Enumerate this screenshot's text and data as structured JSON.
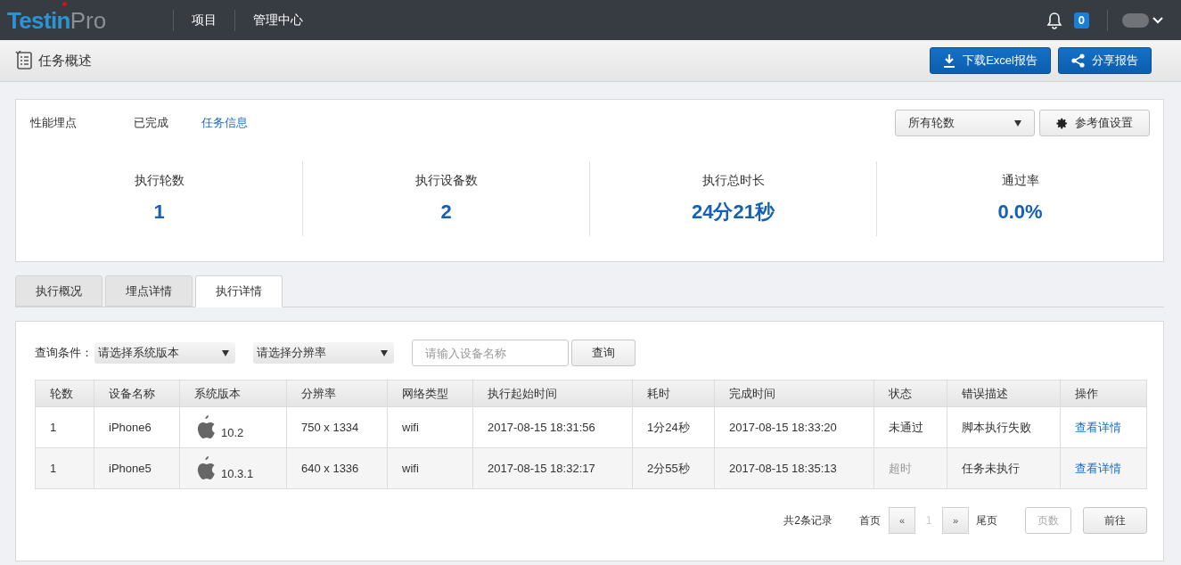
{
  "logo": {
    "brand": "Testin",
    "suffix": "Pro"
  },
  "nav": [
    {
      "label": "项目",
      "selected": false
    },
    {
      "label": "管理中心",
      "selected": false
    }
  ],
  "notifications": {
    "count": "0"
  },
  "page_title": "任务概述",
  "header_buttons": [
    {
      "kind": "download",
      "label": "下载Excel报告"
    },
    {
      "kind": "share",
      "label": "分享报告"
    }
  ],
  "summary": {
    "type": "性能埋点",
    "status": "已完成",
    "info_link": "任务信息",
    "round_select": "所有轮数",
    "settings_button": "参考值设置",
    "stats": [
      {
        "label": "执行轮数",
        "value": "1"
      },
      {
        "label": "执行设备数",
        "value": "2"
      },
      {
        "label": "执行总时长",
        "value": "24分21秒"
      },
      {
        "label": "通过率",
        "value": "0.0%"
      }
    ]
  },
  "tabs": [
    {
      "label": "执行概况",
      "selected": false
    },
    {
      "label": "埋点详情",
      "selected": false
    },
    {
      "label": "执行详情",
      "selected": true
    }
  ],
  "filters": {
    "label": "查询条件：",
    "os_select": "请选择系统版本",
    "resolution_select": "请选择分辨率",
    "device_placeholder": "请输入设备名称",
    "query_button": "查询"
  },
  "table": {
    "columns": [
      "轮数",
      "设备名称",
      "系统版本",
      "分辨率",
      "网络类型",
      "执行起始时间",
      "耗时",
      "完成时间",
      "状态",
      "错误描述",
      "操作"
    ],
    "rows": [
      {
        "round": "1",
        "device": "iPhone6",
        "os": "10.2",
        "resolution": "750 x 1334",
        "network": "wifi",
        "start": "2017-08-15 18:31:56",
        "duration": "1分24秒",
        "end": "2017-08-15 18:33:20",
        "status": "未通过",
        "greyed": false,
        "error": "脚本执行失败",
        "action": "查看详情"
      },
      {
        "round": "1",
        "device": "iPhone5",
        "os": "10.3.1",
        "resolution": "640 x 1336",
        "network": "wifi",
        "start": "2017-08-15 18:32:17",
        "duration": "2分55秒",
        "end": "2017-08-15 18:35:13",
        "status": "超时",
        "greyed": true,
        "error": "任务未执行",
        "action": "查看详情"
      }
    ]
  },
  "pagination": {
    "total": "共2条记录",
    "first": "首页",
    "prev": "«",
    "page": "1",
    "next": "»",
    "last": "尾页",
    "page_placeholder": "页数",
    "go": "前往"
  }
}
